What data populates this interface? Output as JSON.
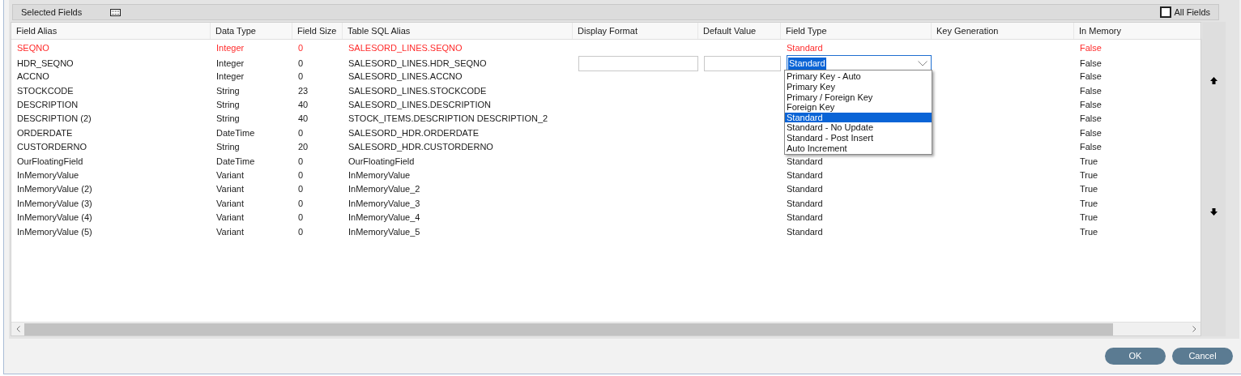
{
  "panel": {
    "title": "Selected Fields",
    "all_fields": {
      "label": "All Fields",
      "checked": false
    }
  },
  "table": {
    "columns": [
      "Field Alias",
      "Data Type",
      "Field Size",
      "Table SQL Alias",
      "Display Format",
      "Default Value",
      "Field Type",
      "Key Generation",
      "In Memory"
    ],
    "rows": [
      {
        "alias": "SEQNO",
        "data_type": "Integer",
        "size": "0",
        "sql_alias": "SALESORD_LINES.SEQNO",
        "field_type": "Standard",
        "in_memory": "False",
        "error": true,
        "editing": false
      },
      {
        "alias": "HDR_SEQNO",
        "data_type": "Integer",
        "size": "0",
        "sql_alias": "SALESORD_LINES.HDR_SEQNO",
        "in_memory": "False",
        "error": false,
        "editing": true
      },
      {
        "alias": "ACCNO",
        "data_type": "Integer",
        "size": "0",
        "sql_alias": "SALESORD_LINES.ACCNO",
        "in_memory": "False",
        "error": false,
        "editing": false
      },
      {
        "alias": "STOCKCODE",
        "data_type": "String",
        "size": "23",
        "sql_alias": "SALESORD_LINES.STOCKCODE",
        "in_memory": "False",
        "error": false,
        "editing": false
      },
      {
        "alias": "DESCRIPTION",
        "data_type": "String",
        "size": "40",
        "sql_alias": "SALESORD_LINES.DESCRIPTION",
        "in_memory": "False",
        "error": false,
        "editing": false
      },
      {
        "alias": "DESCRIPTION (2)",
        "data_type": "String",
        "size": "40",
        "sql_alias": "STOCK_ITEMS.DESCRIPTION DESCRIPTION_2",
        "in_memory": "False",
        "error": false,
        "editing": false
      },
      {
        "alias": "ORDERDATE",
        "data_type": "DateTime",
        "size": "0",
        "sql_alias": "SALESORD_HDR.ORDERDATE",
        "in_memory": "False",
        "error": false,
        "editing": false
      },
      {
        "alias": "CUSTORDERNO",
        "data_type": "String",
        "size": "20",
        "sql_alias": "SALESORD_HDR.CUSTORDERNO",
        "in_memory": "False",
        "error": false,
        "editing": false
      },
      {
        "alias": "OurFloatingField",
        "data_type": "DateTime",
        "size": "0",
        "sql_alias": "OurFloatingField",
        "field_type": "Standard",
        "in_memory": "True",
        "error": false,
        "editing": false
      },
      {
        "alias": "InMemoryValue",
        "data_type": "Variant",
        "size": "0",
        "sql_alias": "InMemoryValue",
        "field_type": "Standard",
        "in_memory": "True",
        "error": false,
        "editing": false
      },
      {
        "alias": "InMemoryValue (2)",
        "data_type": "Variant",
        "size": "0",
        "sql_alias": "InMemoryValue_2",
        "field_type": "Standard",
        "in_memory": "True",
        "error": false,
        "editing": false
      },
      {
        "alias": "InMemoryValue (3)",
        "data_type": "Variant",
        "size": "0",
        "sql_alias": "InMemoryValue_3",
        "field_type": "Standard",
        "in_memory": "True",
        "error": false,
        "editing": false
      },
      {
        "alias": "InMemoryValue (4)",
        "data_type": "Variant",
        "size": "0",
        "sql_alias": "InMemoryValue_4",
        "field_type": "Standard",
        "in_memory": "True",
        "error": false,
        "editing": false
      },
      {
        "alias": "InMemoryValue (5)",
        "data_type": "Variant",
        "size": "0",
        "sql_alias": "InMemoryValue_5",
        "field_type": "Standard",
        "in_memory": "True",
        "error": false,
        "editing": false
      }
    ]
  },
  "field_type_dropdown": {
    "value": "Standard",
    "options": [
      {
        "label": "Primary Key - Auto",
        "selected": false
      },
      {
        "label": "Primary Key",
        "selected": false
      },
      {
        "label": "Primary / Foreign Key",
        "selected": false
      },
      {
        "label": "Foreign Key",
        "selected": false
      },
      {
        "label": "Standard",
        "selected": true
      },
      {
        "label": "Standard - No Update",
        "selected": false
      },
      {
        "label": "Standard - Post Insert",
        "selected": false
      },
      {
        "label": "Auto Increment",
        "selected": false
      }
    ]
  },
  "buttons": [
    "OK",
    "Cancel"
  ]
}
